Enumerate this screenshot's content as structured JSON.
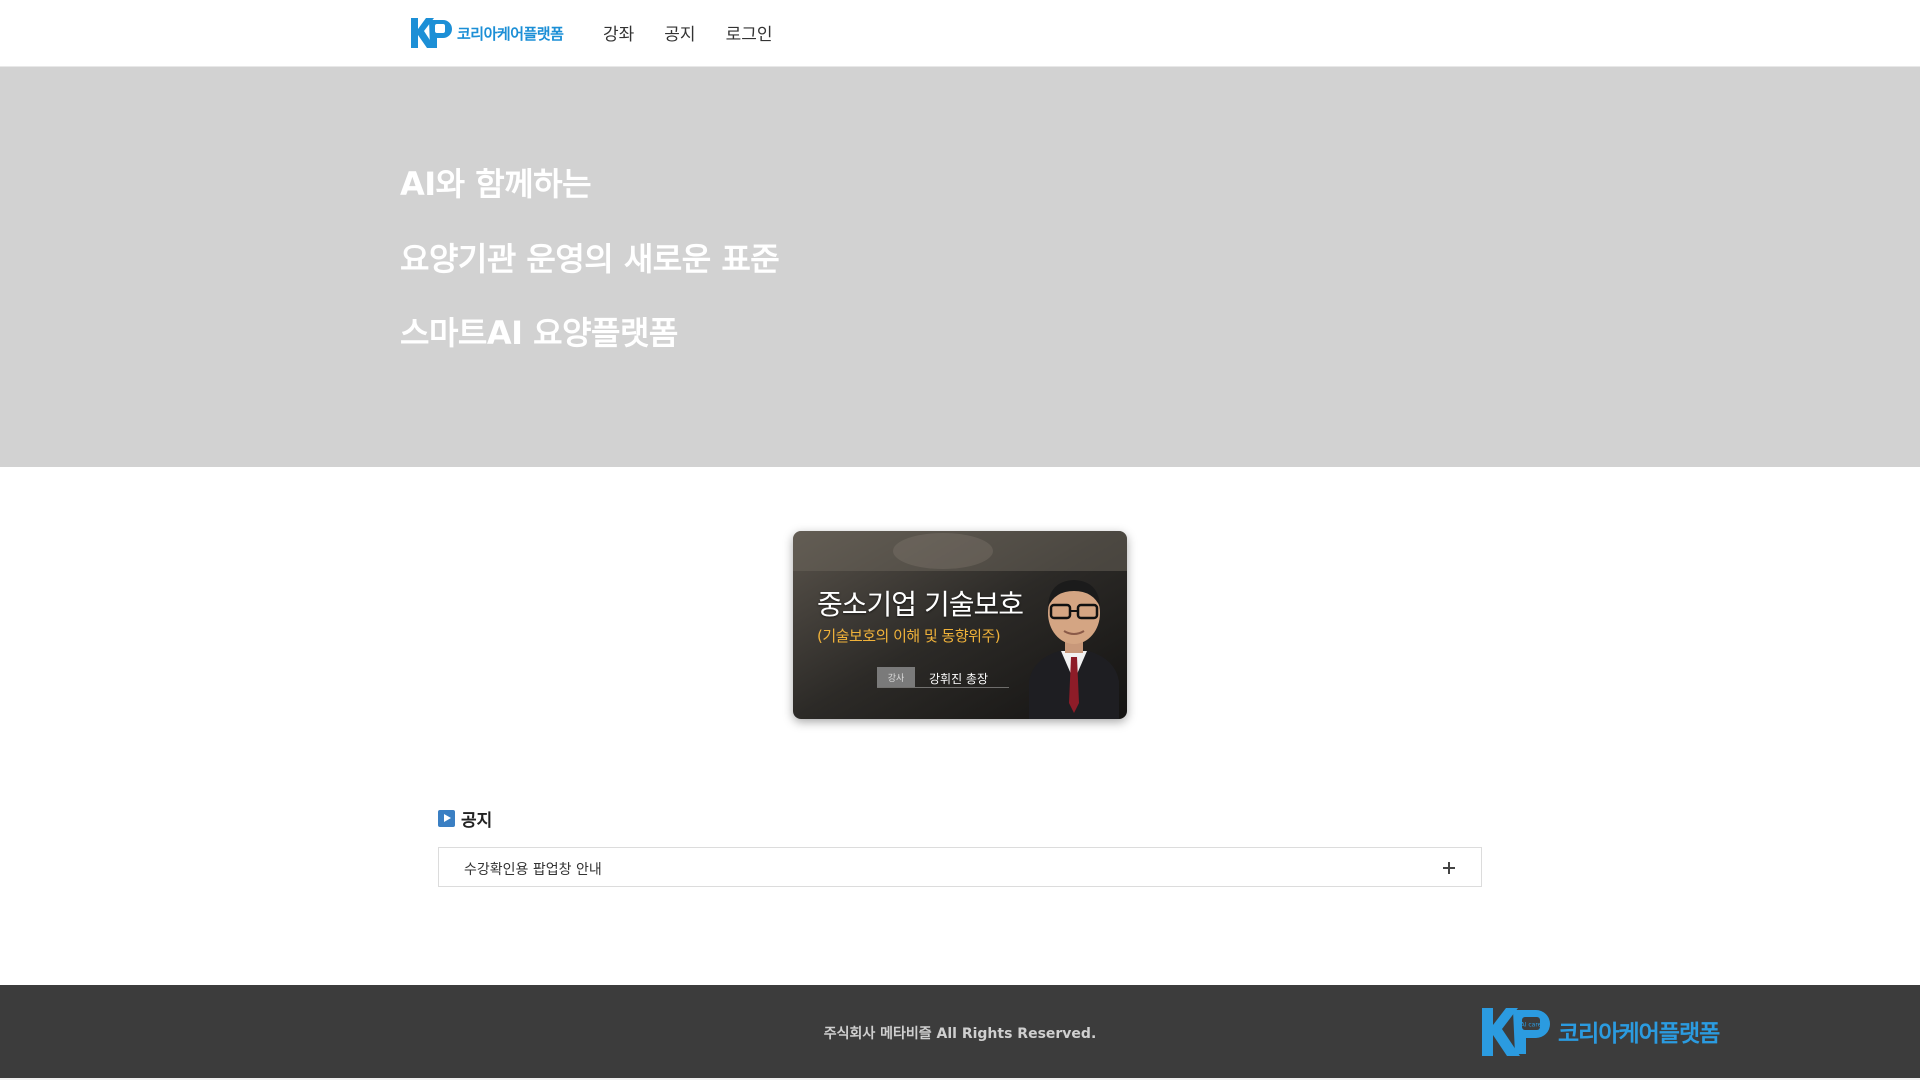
{
  "header": {
    "logo_text": "코리아케어플랫폼",
    "logo_badge": "AI care",
    "nav": [
      {
        "label": "강좌"
      },
      {
        "label": "공지"
      },
      {
        "label": "로그인"
      }
    ]
  },
  "hero": {
    "lines": [
      "AI와 함께하는",
      "요양기관 운영의 새로운 표준",
      "스마트AI 요양플랫폼"
    ]
  },
  "course": {
    "title": "중소기업 기술보호",
    "subtitle": "(기술보호의 이해 및 동향위주)",
    "instructor_tag": "강사",
    "instructor_name": "강휘진 총장"
  },
  "notice": {
    "heading": "공지",
    "items": [
      {
        "title": "수강확인용 팝업창 안내"
      }
    ]
  },
  "footer": {
    "copyright": "주식회사 메타비즐 All Rights Reserved.",
    "logo_text": "코리아케어플랫폼",
    "logo_badge": "AI care"
  },
  "colors": {
    "brand_blue": "#1c8fd6",
    "hero_bg": "#d2d2d2",
    "footer_bg": "#3c3c3c",
    "accent_orange": "#f0b23a"
  }
}
